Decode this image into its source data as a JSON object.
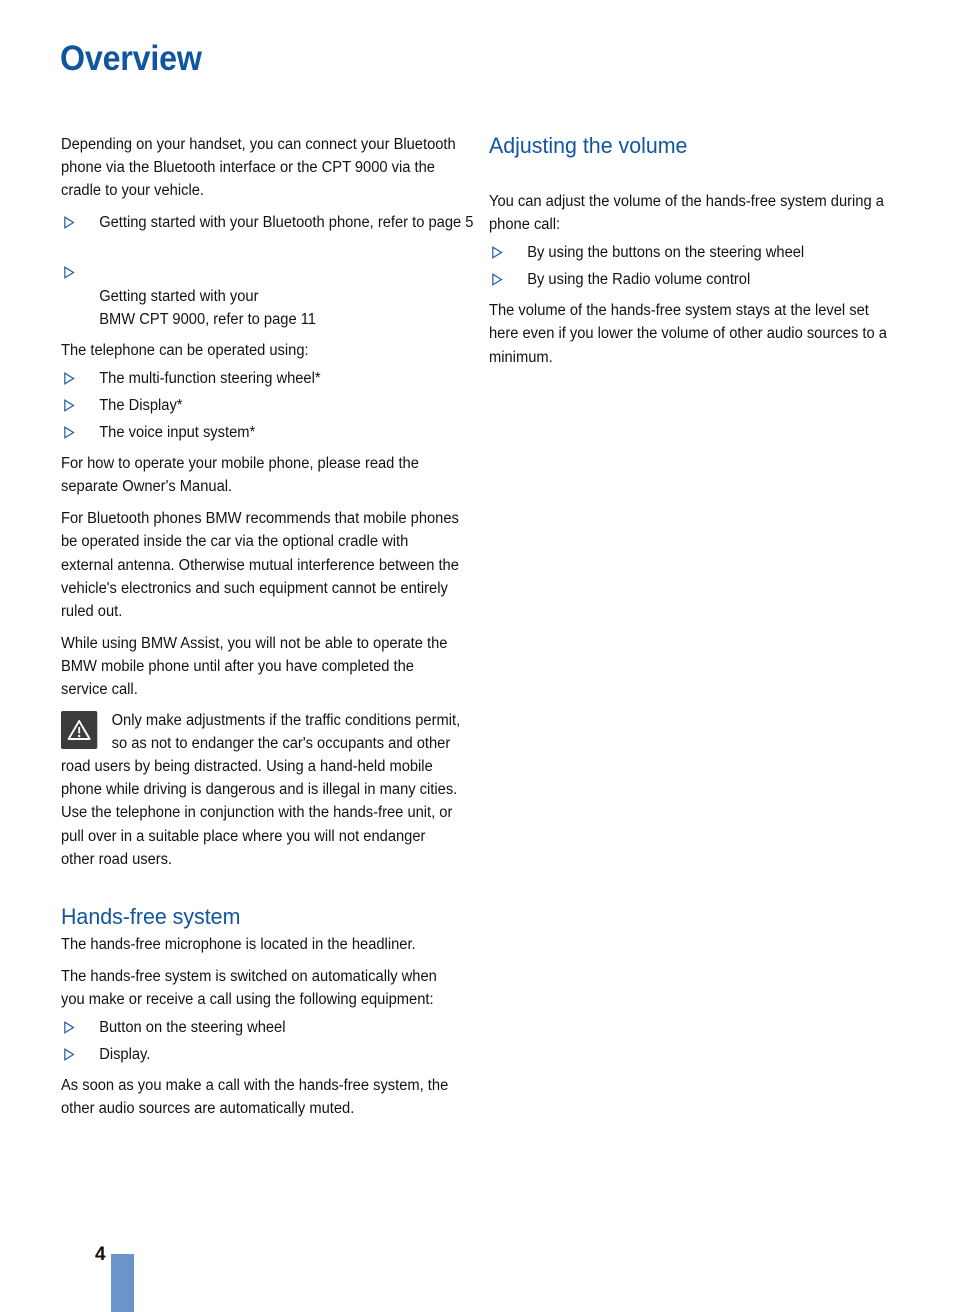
{
  "page": {
    "title": "Overview",
    "number": "4"
  },
  "colors": {
    "title_blue": "#10559f",
    "heading_blue": "#10559f",
    "bullet_blue": "#2a5fa8",
    "page_bar_blue": "#6b94c9",
    "warning_icon_bg": "#3c3c3c",
    "body_text": "#131313"
  },
  "left_column": {
    "intro_paragraph": "Depending on your handset, you can connect your Bluetooth phone via the Bluetooth interface or the CPT 9000 via the cradle to your vehicle.",
    "getting_started_bullets": [
      "Getting started with your Bluetooth phone, refer to page 5",
      "Getting started with your\nBMW CPT 9000, refer to page 11"
    ],
    "operated_using_lead": "The telephone can be operated using:",
    "operated_using_bullets": [
      "The multi-function steering wheel*",
      "The Display*",
      "The voice input system*"
    ],
    "owners_manual_paragraph": "For how to operate your mobile phone, please read the separate Owner's Manual.",
    "cradle_paragraph": "For Bluetooth phones BMW recommends that mobile phones be operated inside the car via the optional cradle with external antenna. Otherwise mutual interference between the vehicle's electronics and such equipment cannot be entirely ruled out.",
    "bmw_assist_paragraph": "While using BMW Assist, you will not be able to operate the BMW mobile phone until after you have completed the service call.",
    "warning_text": "Only make adjustments if the traffic conditions permit, so as not to endanger the car's occupants and other road users by being distracted. Using a hand-held mobile phone while driving is dangerous and is illegal in many cities. Use the telephone in conjunction with the hands-free unit, or pull over in a suitable place where you will not endanger other road users.",
    "hands_free": {
      "heading": "Hands-free system",
      "microphone_paragraph": "The hands-free microphone is located in the headliner.",
      "switched_on_paragraph": "The hands-free system is switched on automatically when you make or receive a call using the following equipment:",
      "equipment_bullets": [
        "Button on the steering wheel",
        "Display."
      ],
      "muted_paragraph": "As soon as you make a call with the hands-free system, the other audio sources are automatically muted."
    }
  },
  "right_column": {
    "adjusting_volume": {
      "heading": "Adjusting the volume",
      "intro_paragraph": "You can adjust the volume of the hands-free system during a phone call:",
      "bullets": [
        "By using the buttons on the steering wheel",
        "By using the Radio volume control"
      ],
      "level_paragraph": "The volume of the hands-free system stays at the level set here even if you lower the volume of other audio sources to a minimum."
    }
  }
}
